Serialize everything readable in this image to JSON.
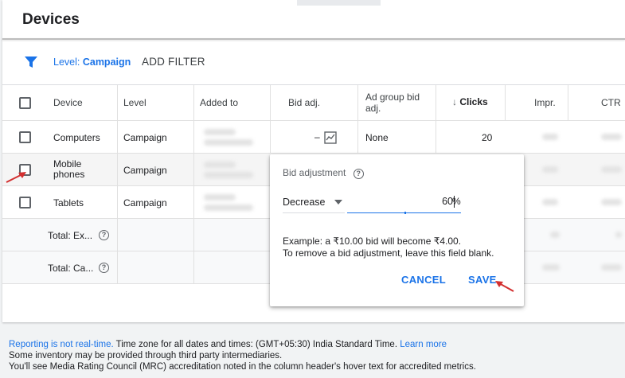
{
  "page": {
    "title": "Devices"
  },
  "filter": {
    "level_label": "Level:",
    "level_value": "Campaign",
    "add_filter": "ADD FILTER"
  },
  "table": {
    "headers": {
      "device": "Device",
      "level": "Level",
      "added_to": "Added to",
      "bid_adj": "Bid adj.",
      "ad_group_bid_adj_1": "Ad group bid",
      "ad_group_bid_adj_2": "adj.",
      "clicks": "Clicks",
      "impr": "Impr.",
      "ctr": "CTR"
    },
    "rows": [
      {
        "device": "Computers",
        "level": "Campaign",
        "bid_adj": "–",
        "ad_group_bid_adj": "None",
        "clicks": "20"
      },
      {
        "device_1": "Mobile",
        "device_2": "phones",
        "level": "Campaign"
      },
      {
        "device": "Tablets",
        "level": "Campaign"
      }
    ],
    "totals": [
      {
        "label": "Total: Ex..."
      },
      {
        "label": "Total: Ca..."
      }
    ]
  },
  "popup": {
    "title": "Bid adjustment",
    "dropdown_value": "Decrease",
    "input_value": "60",
    "unit": "%",
    "example_line1": "Example: a ₹10.00 bid will become ₹4.00.",
    "example_line2": "To remove a bid adjustment, leave this field blank.",
    "cancel": "CANCEL",
    "save": "SAVE"
  },
  "footer": {
    "realtime_link": "Reporting is not real-time.",
    "timezone_text": " Time zone for all dates and times: (GMT+05:30) India Standard Time.",
    "learn_more": "Learn more",
    "line2": "Some inventory may be provided through third party intermediaries.",
    "line3": "You'll see Media Rating Council (MRC) accreditation noted in the column header's hover text for accredited metrics."
  },
  "colors": {
    "accent": "#1a73e8",
    "annotation_arrow": "#d32f2f"
  },
  "icons": {
    "filter": "filter-icon",
    "sort": "arrow-down-icon",
    "chart": "line-chart-icon",
    "help": "help-circle-icon",
    "dropdown": "caret-down-icon"
  }
}
